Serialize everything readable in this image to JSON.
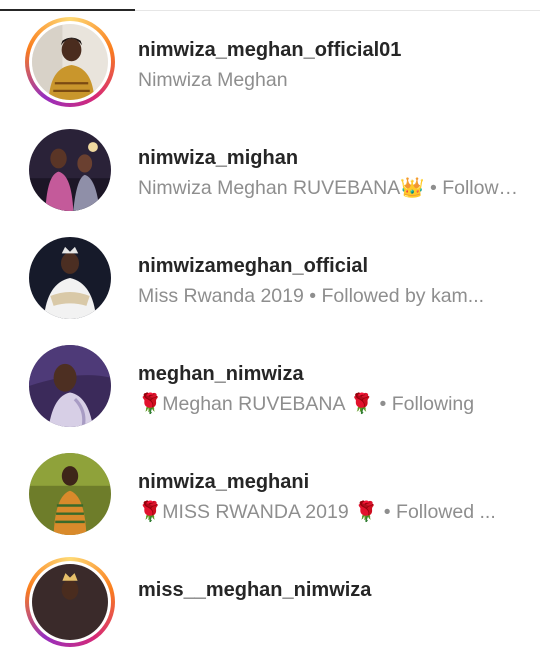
{
  "results": [
    {
      "username": "nimwiza_meghan_official01",
      "subtitle": "Nimwiza Meghan",
      "has_story": true,
      "photo": {
        "bg": "#e9e4dc",
        "accent": "#c9962c",
        "skin": "#4a2c1e"
      }
    },
    {
      "username": "nimwiza_mighan",
      "subtitle": "Nimwiza Meghan RUVEBANA👑 • Followed by ...",
      "has_story": false,
      "photo": {
        "bg": "#2a2238",
        "accent": "#c45a9a",
        "skin": "#5a3526"
      }
    },
    {
      "username": "nimwizameghan_official",
      "subtitle": "Miss Rwanda 2019 • Followed by kam...",
      "has_story": false,
      "photo": {
        "bg": "#161a2a",
        "accent": "#f2f2f2",
        "skin": "#4b2e22"
      }
    },
    {
      "username": "meghan_nimwiza",
      "subtitle": "🌹Meghan RUVEBANA 🌹 • Following",
      "has_story": false,
      "photo": {
        "bg": "#3b2a5a",
        "accent": "#d7cfe6",
        "skin": "#4d2f22"
      }
    },
    {
      "username": "nimwiza_meghani",
      "subtitle": "🌹MISS RWANDA 2019 🌹 • Followed ...",
      "has_story": false,
      "photo": {
        "bg": "#6e7d2a",
        "accent": "#d98a2b",
        "skin": "#3e2519"
      }
    },
    {
      "username": "miss__meghan_nimwiza",
      "subtitle": "",
      "has_story": true,
      "photo": {
        "bg": "#3a2a2a",
        "accent": "#e6c06a",
        "skin": "#4a2c1e"
      }
    }
  ]
}
